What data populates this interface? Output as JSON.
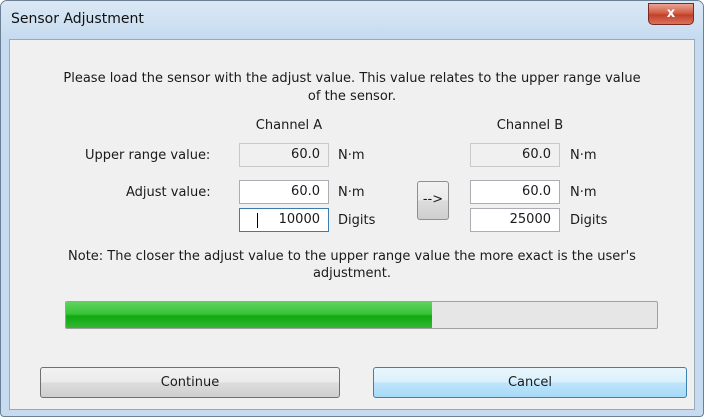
{
  "window": {
    "title": "Sensor Adjustment",
    "close_glyph": "x"
  },
  "instructions": {
    "line1": "Please load the sensor with the adjust value. This value relates to the upper range value",
    "line2": "of the sensor."
  },
  "channels": {
    "a_label": "Channel A",
    "b_label": "Channel B"
  },
  "upper_range": {
    "label": "Upper range value:",
    "channel_a": {
      "value": "60.0",
      "unit": "N·m"
    },
    "channel_b": {
      "value": "60.0",
      "unit": "N·m"
    }
  },
  "adjust": {
    "label": "Adjust value:",
    "channel_a": {
      "value": "60.0",
      "unit": "N·m",
      "digits": "10000",
      "digits_unit": "Digits"
    },
    "channel_b": {
      "value": "60.0",
      "unit": "N·m",
      "digits": "25000",
      "digits_unit": "Digits"
    },
    "copy_button": "-->"
  },
  "note": {
    "line1": "Note: The closer the adjust value to the upper range value the more exact is the user's",
    "line2": "adjustment."
  },
  "progress": {
    "fraction": 0.62,
    "fill_color": "#22b422"
  },
  "buttons": {
    "continue": "Continue",
    "cancel": "Cancel"
  }
}
